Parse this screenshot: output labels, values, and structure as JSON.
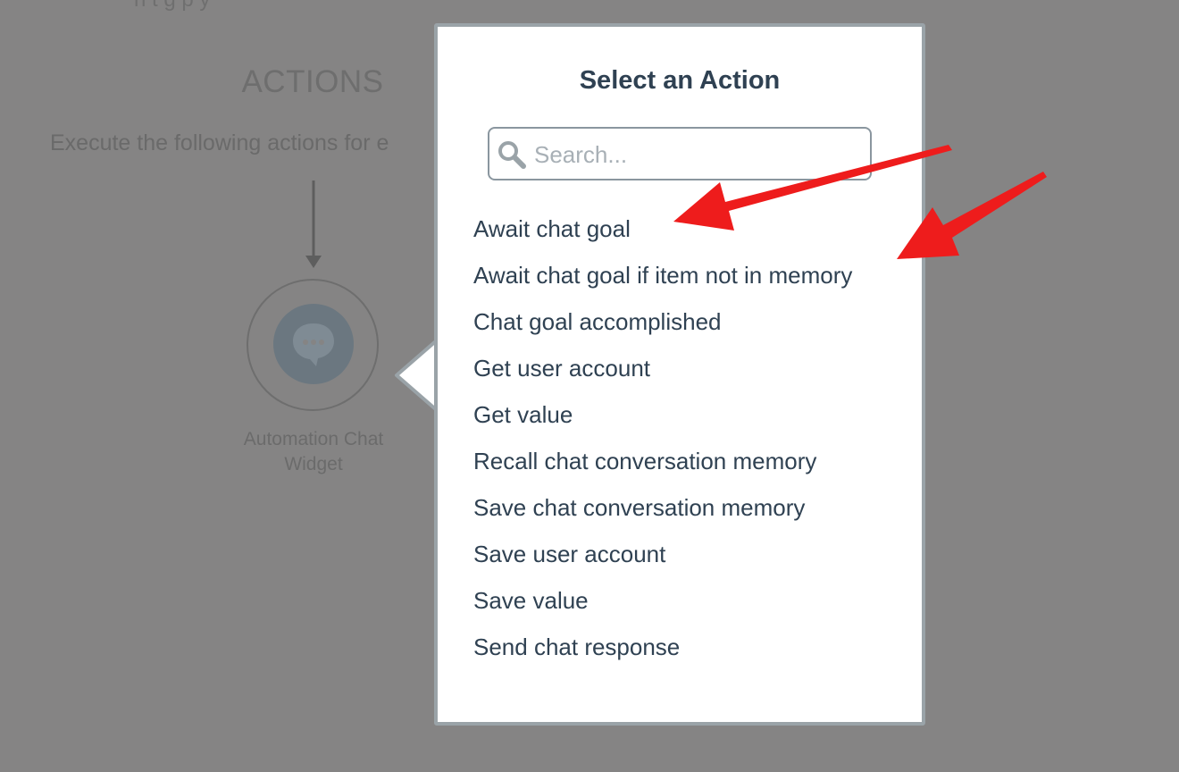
{
  "background": {
    "cut_text": "h t g p   y",
    "section_title": "ACTIONS",
    "section_desc": "Execute the following actions for e",
    "node": {
      "icon": "chat-bubble-ellipsis-icon",
      "label_line1": "Automation Chat",
      "label_line2": "Widget"
    }
  },
  "modal": {
    "title": "Select an Action",
    "search": {
      "placeholder": "Search...",
      "value": "",
      "icon": "search-icon"
    },
    "actions": [
      "Await chat goal",
      "Await chat goal if item not in memory",
      "Chat goal accomplished",
      "Get user account",
      "Get value",
      "Recall chat conversation memory",
      "Save chat conversation memory",
      "Save user account",
      "Save value",
      "Send chat response"
    ]
  },
  "annotations": {
    "arrow_color": "#ee1c1c",
    "count": 2
  },
  "colors": {
    "overlay": "#858484",
    "text_dark": "#2f4152",
    "modal_border": "#9aa3a8"
  }
}
